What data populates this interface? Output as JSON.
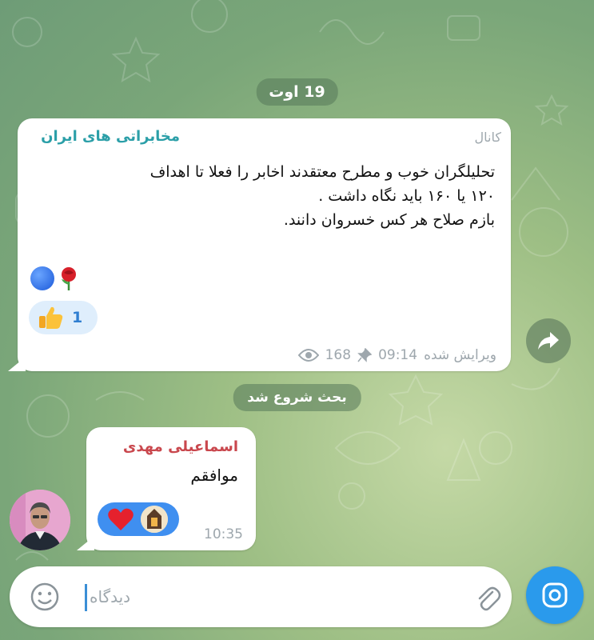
{
  "date_separator": "19 اوت",
  "post": {
    "label": "کانال",
    "channel_name": "مخابراتی های ایران",
    "lines": [
      "تحلیلگران خوب و مطرح معتقدند اخابر را فعلا تا اهداف",
      "۱۲۰ یا ۱۶۰ باید نگاه داشت .",
      "بازم صلاح هر کس خسروان دانند."
    ],
    "emoji_icons": [
      "blue-circle",
      "rose"
    ],
    "reaction": {
      "icon": "thumbs-up",
      "count": "1"
    },
    "edited_label": "ویرایش شده",
    "time": "09:14",
    "views": "168"
  },
  "discussion_label": "بحث شروع شد",
  "comment": {
    "author": "اسماعیلی مهدی",
    "text": "موافقم",
    "reactions": [
      "heart",
      "lantern-avatar"
    ],
    "time": "10:35"
  },
  "composer": {
    "placeholder": "دیدگاه"
  },
  "colors": {
    "accent": "#2a9aec",
    "channel_name": "#2b9fa8",
    "author_name": "#c9474d"
  }
}
